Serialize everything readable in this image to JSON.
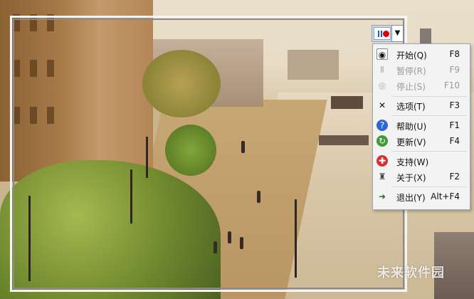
{
  "toolbar": {
    "record_icon": "record-icon",
    "dropdown_icon": "chevron-down-icon",
    "dropdown_glyph": "▼"
  },
  "menu": {
    "items": [
      {
        "label": "开始(Q)",
        "shortcut": "F8",
        "icon": "camera-icon",
        "glyph": "◉",
        "enabled": true
      },
      {
        "label": "暂停(R)",
        "shortcut": "F9",
        "icon": "pause-icon",
        "glyph": "Ⅱ",
        "enabled": false
      },
      {
        "label": "停止(S)",
        "shortcut": "F10",
        "icon": "stop-icon",
        "glyph": "◎",
        "enabled": false
      },
      {
        "label": "选项(T)",
        "shortcut": "F3",
        "icon": "tools-icon",
        "glyph": "✕",
        "enabled": true
      },
      {
        "label": "帮助(U)",
        "shortcut": "F1",
        "icon": "help-icon",
        "glyph": "?",
        "enabled": true
      },
      {
        "label": "更新(V)",
        "shortcut": "F4",
        "icon": "update-icon",
        "glyph": "↻",
        "enabled": true
      },
      {
        "label": "支持(W)",
        "shortcut": "",
        "icon": "support-icon",
        "glyph": "✚",
        "enabled": true
      },
      {
        "label": "关于(X)",
        "shortcut": "F2",
        "icon": "about-icon",
        "glyph": "♜",
        "enabled": true
      },
      {
        "label": "退出(Y)",
        "shortcut": "Alt+F4",
        "icon": "exit-icon",
        "glyph": "➜",
        "enabled": true
      }
    ]
  },
  "watermark": {
    "text": "未来软件园"
  },
  "colors": {
    "record_red": "#e00000",
    "menu_bg": "#f3f3f3",
    "disabled_text": "#9a9a9a"
  }
}
